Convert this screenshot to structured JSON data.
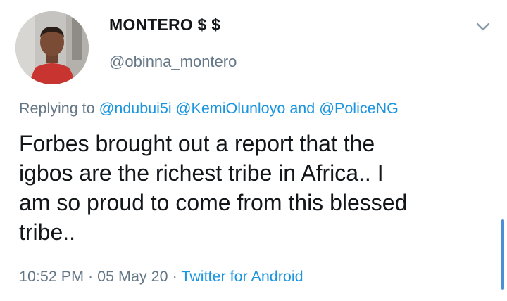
{
  "tweet": {
    "display_name": "MONTERO $ $",
    "handle": "@obinna_montero",
    "reply_prefix": "Replying to",
    "mentions": [
      "@ndubui5i",
      "@KemiOlunloyo",
      "@PoliceNG"
    ],
    "mention_joiner": "and",
    "text_lines": [
      "Forbes brought out a report that the",
      "igbos are the richest tribe in Africa.. I",
      "am so proud to come from this blessed",
      "tribe.."
    ],
    "time": "10:52 PM",
    "date": "05 May 20",
    "separator": "·",
    "source": "Twitter for Android"
  },
  "colors": {
    "text": "#14171a",
    "muted": "#657786",
    "link": "#1b95e0",
    "scroll_indicator": "#4a90d9"
  },
  "icons": {
    "menu": "chevron-down-icon",
    "avatar": "profile-photo"
  }
}
